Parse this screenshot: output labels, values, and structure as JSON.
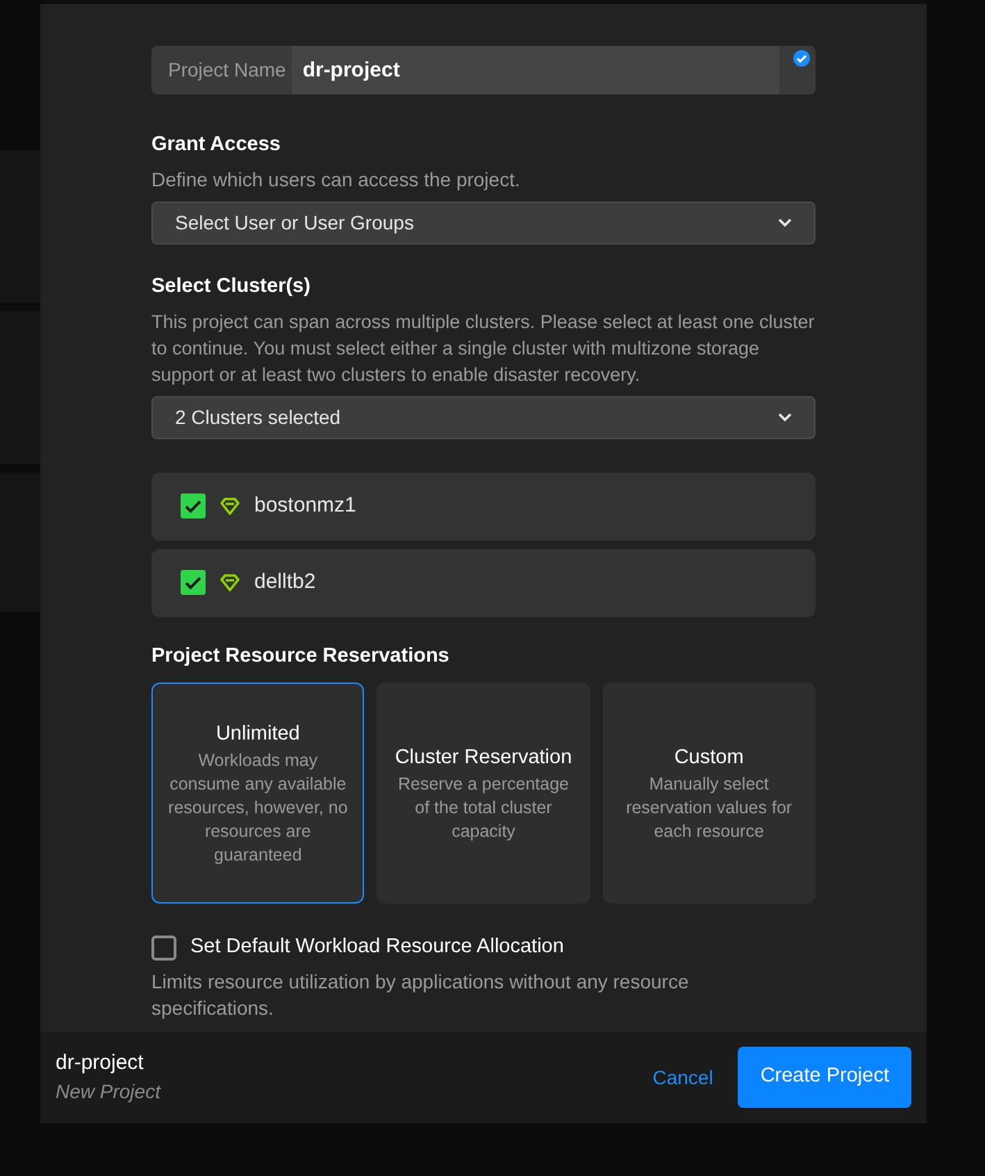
{
  "project_name": {
    "label": "Project Name",
    "value": "dr-project",
    "validated": true
  },
  "grant_access": {
    "title": "Grant Access",
    "description": "Define which users can access the project.",
    "dropdown": "Select User or User Groups"
  },
  "clusters": {
    "title": "Select Cluster(s)",
    "description": "This project can span across multiple clusters. Please select at least one cluster to continue. You must select either a single cluster with multizone storage support or at least two clusters to enable disaster recovery.",
    "dropdown": "2 Clusters selected",
    "items": [
      {
        "name": "bostonmz1",
        "checked": true
      },
      {
        "name": "delltb2",
        "checked": true
      }
    ]
  },
  "reservations": {
    "title": "Project Resource Reservations",
    "options": [
      {
        "title": "Unlimited",
        "description": "Workloads may consume any available resources, however, no resources are guaranteed",
        "selected": true
      },
      {
        "title": "Cluster Reservation",
        "description": "Reserve a percentage of the total cluster capacity",
        "selected": false
      },
      {
        "title": "Custom",
        "description": "Manually select reservation values for each resource",
        "selected": false
      }
    ]
  },
  "default_allocation": {
    "label": "Set Default Workload Resource Allocation",
    "checked": false,
    "description": "Limits resource utilization by applications without any resource specifications."
  },
  "footer": {
    "title": "dr-project",
    "subtitle": "New Project",
    "cancel": "Cancel",
    "submit": "Create Project"
  }
}
